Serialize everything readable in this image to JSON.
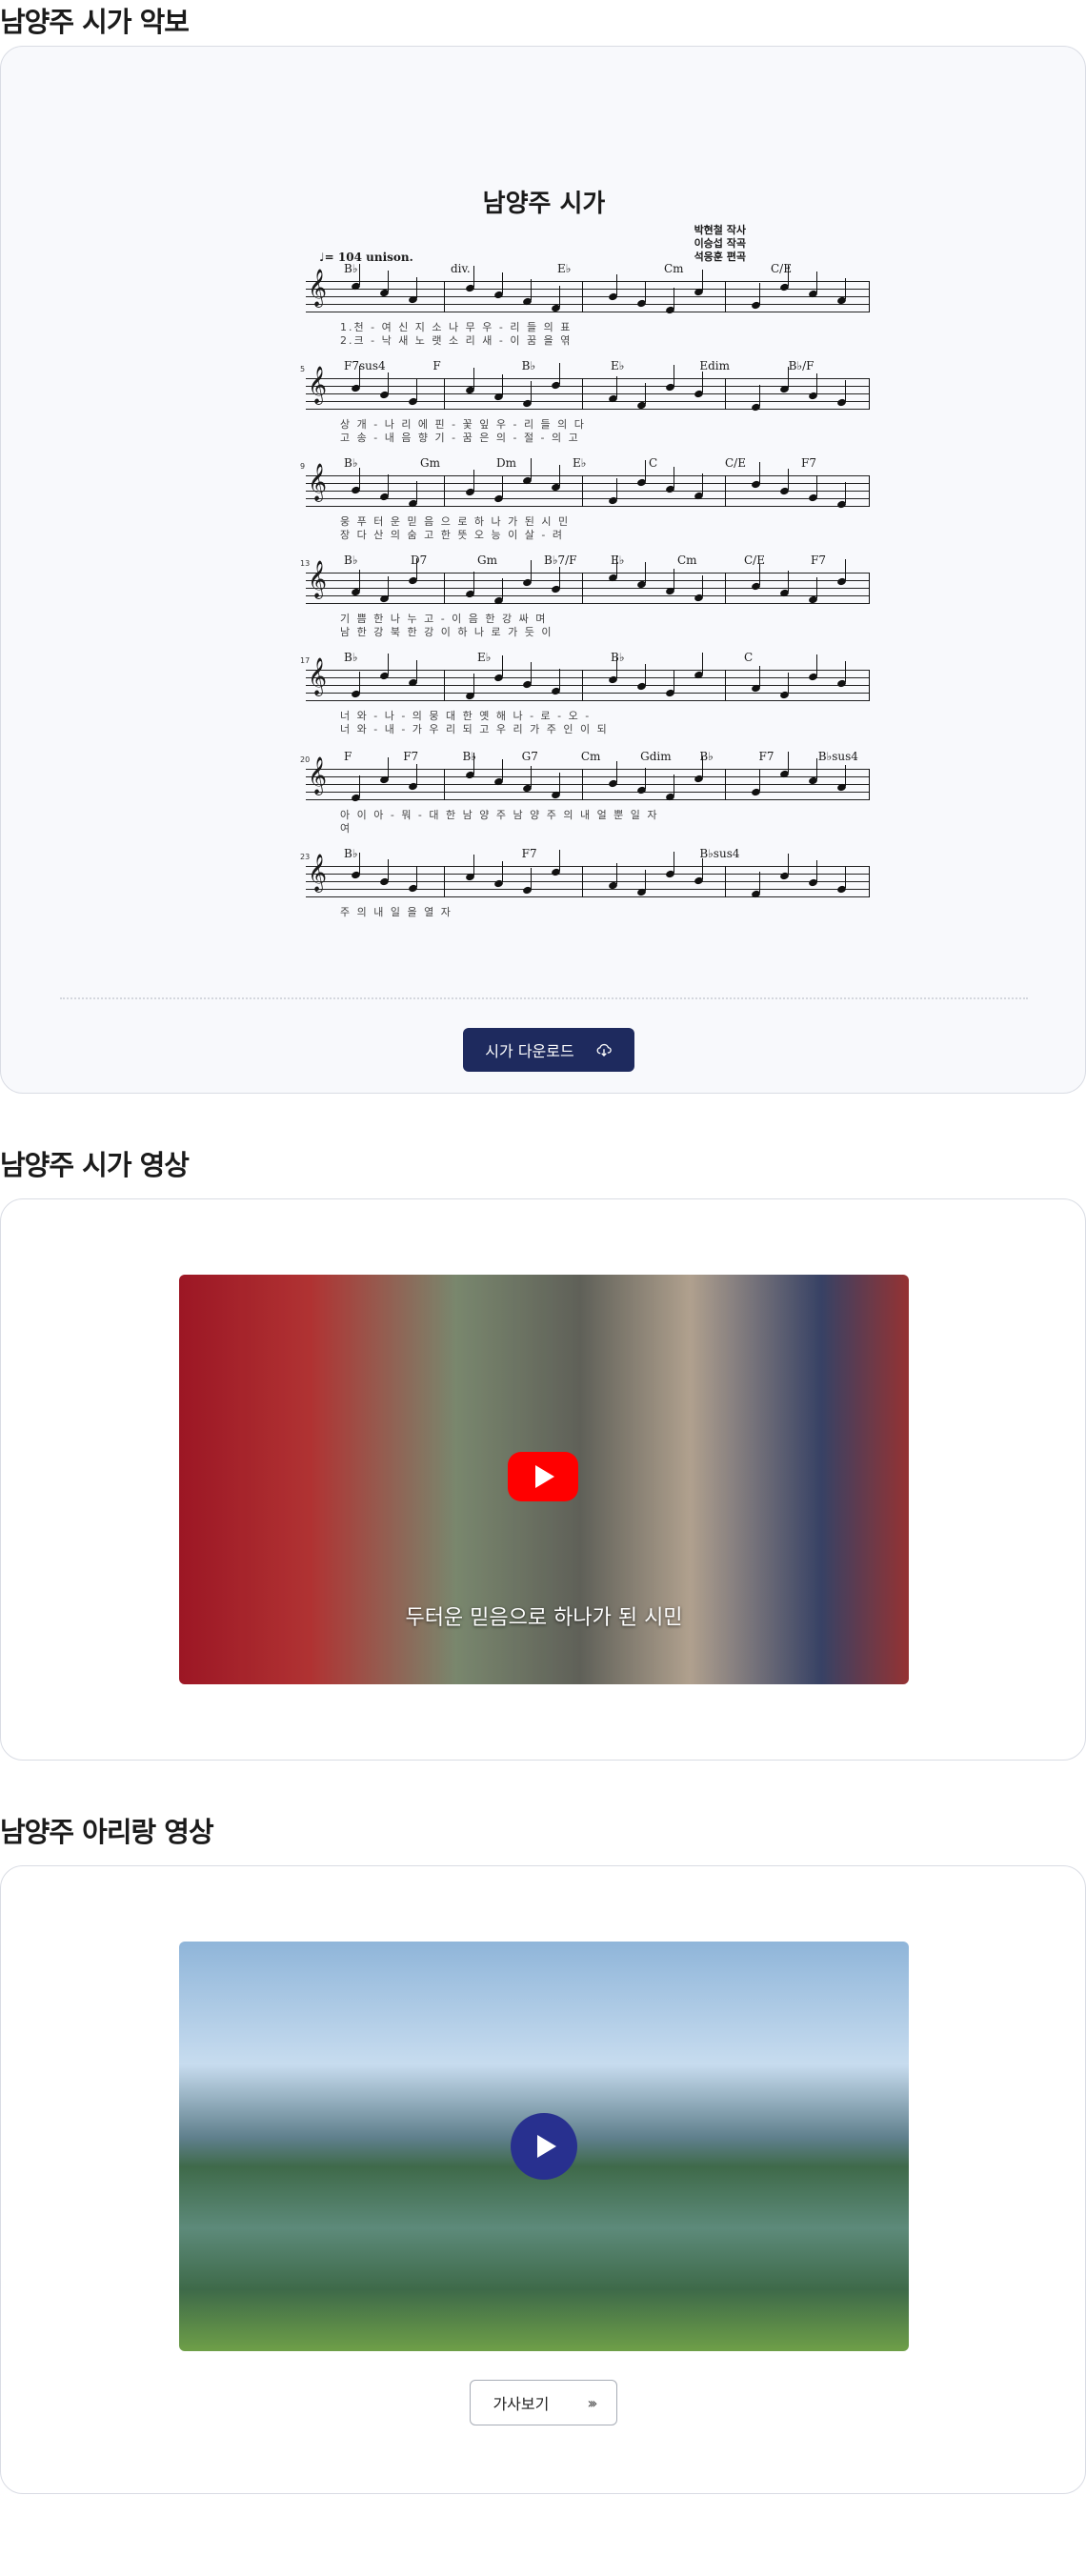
{
  "sections": [
    {
      "title": "남양주 시가 악보"
    },
    {
      "title": "남양주 시가 영상"
    },
    {
      "title": "남양주 아리랑 영상"
    }
  ],
  "sheet": {
    "title": "남양주 시가",
    "credits": [
      "박현철 작사",
      "이승섭 작곡",
      "석응훈 편곡"
    ],
    "tempo": "♩= 104",
    "unison": "unison.",
    "div": "div.",
    "rows": [
      {
        "num": "",
        "chords": [
          "B♭",
          "div.",
          "E♭",
          "Cm",
          "C/E"
        ],
        "lyrics1": "1.천  -  여  신  지  소  나  무        우  -  리  들  의  표",
        "lyrics2": "2.크  -  낙  새  노  랫  소  리        새  -  이  꿈  을  엮"
      },
      {
        "num": "5",
        "chords": [
          "F7sus4",
          "F",
          "B♭",
          "E♭",
          "Edim",
          "B♭/F"
        ],
        "lyrics1": "상   개  -  나   리  에  핀  -  꽃     잎    우  -  리    들 의 다",
        "lyrics2": "고   송  -  내   음  향  기  -  꿈     은    의  -  절  -  의 고"
      },
      {
        "num": "9",
        "chords": [
          "B♭",
          "Gm",
          "Dm",
          "E♭",
          "C",
          "C/E",
          "F7"
        ],
        "lyrics1": "웅          푸 터 운 믿   음   으   로          하 나 가 된   시   민",
        "lyrics2": "장          다 산 의 숨   고   한   뜻          오 능 이 살   -   려"
      },
      {
        "num": "13",
        "chords": [
          "B♭",
          "D7",
          "Gm",
          "B♭7/F",
          "E♭",
          "Cm",
          "C/E",
          "F7"
        ],
        "lyrics1": "기 쁨 한 나   누   고   -          이 음 한 강   싸   며",
        "lyrics2": "남 한 강 북   한   강   이          하 나 로 가   듯   이"
      },
      {
        "num": "17",
        "chords": [
          "B♭",
          "E♭",
          "B♭",
          "C"
        ],
        "lyrics1": "너  와 - 나  -  의        뭉    대    한  옛              해 나 - 로 - 오 -",
        "lyrics2": "너  와 - 내  -  가        우    리    되  고              우 리 가 주 인 이 되"
      },
      {
        "num": "20",
        "chords": [
          "F",
          "F7",
          "B♭",
          "G7",
          "Cm",
          "Gdim",
          "B♭",
          "F7",
          "B♭sus4"
        ],
        "lyrics1": "아          이  아 -  뭐 - 대 한  남   양 주   남 양 주   의 내 얼 뿐 일   자",
        "lyrics2": "여"
      },
      {
        "num": "23",
        "chords": [
          "B♭",
          "F7",
          "B♭sus4"
        ],
        "lyrics1": "주        의       내   일   을   열        자",
        "lyrics2": ""
      }
    ]
  },
  "download_button": {
    "label": "시가 다운로드"
  },
  "video1": {
    "caption": "두터운 믿음으로 하나가 된 시민"
  },
  "video2": {
    "caption": ""
  },
  "lyrics_button": {
    "label": "가사보기"
  },
  "colors": {
    "primary": "#1e2a5e",
    "youtube": "#ff0000",
    "play_round": "#28308f",
    "border": "#d9dce4"
  },
  "icons": {
    "download": "cloud-download-icon",
    "play": "play-icon",
    "chevron": "double-chevron-right-icon"
  }
}
